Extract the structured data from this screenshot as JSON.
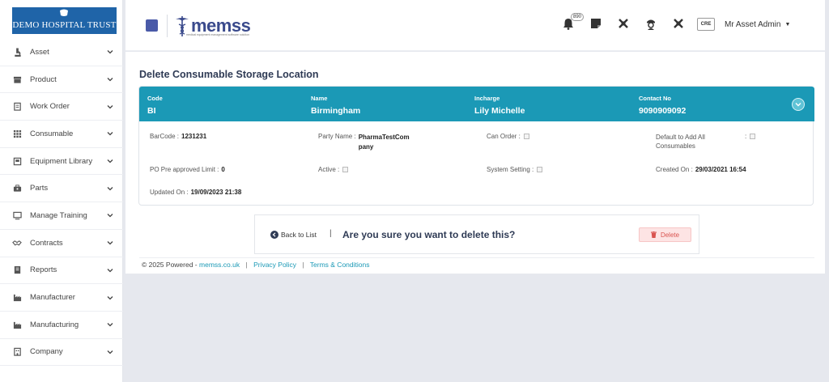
{
  "brand": {
    "name": "DEMO HOSPITAL TRUST",
    "bg": "#1f64a8"
  },
  "sidebar": {
    "items": [
      {
        "label": "Asset",
        "icon": "microscope-icon"
      },
      {
        "label": "Product",
        "icon": "box-icon"
      },
      {
        "label": "Work Order",
        "icon": "clipboard-icon"
      },
      {
        "label": "Consumable",
        "icon": "grid-icon"
      },
      {
        "label": "Equipment Library",
        "icon": "book-icon"
      },
      {
        "label": "Parts",
        "icon": "toolbox-icon"
      },
      {
        "label": "Manage Training",
        "icon": "monitor-icon"
      },
      {
        "label": "Contracts",
        "icon": "handshake-icon"
      },
      {
        "label": "Reports",
        "icon": "report-icon"
      },
      {
        "label": "Manufacturer",
        "icon": "factory-icon"
      },
      {
        "label": "Manufacturing",
        "icon": "factory-icon"
      },
      {
        "label": "Company",
        "icon": "building-icon"
      }
    ]
  },
  "topbar": {
    "logo_word": "memss",
    "logo_tagline": "medical equipment management software solution",
    "notification_count": "890",
    "user_name": "Mr Asset Admin",
    "avatar_text": "CRE"
  },
  "page": {
    "title": "Delete Consumable Storage Location"
  },
  "record": {
    "header": [
      {
        "label": "Code",
        "value": "BI"
      },
      {
        "label": "Name",
        "value": "Birmingham"
      },
      {
        "label": "Incharge",
        "value": "Lily Michelle"
      },
      {
        "label": "Contact No",
        "value": "9090909092"
      }
    ],
    "barcode_label": "BarCode :",
    "barcode_value": "1231231",
    "party_label": "Party Name :",
    "party_value_1": "PharmaTestCom",
    "party_value_2": "pany",
    "can_order_label": "Can Order :",
    "default_label_1": "Default to Add All",
    "default_label_2": "Consumables",
    "default_colon": ":",
    "po_label": "PO Pre approved Limit :",
    "po_value": "0",
    "active_label": "Active :",
    "system_label": "System Setting :",
    "created_label": "Created On :",
    "created_value": "29/03/2021 16:54",
    "updated_label": "Updated On :",
    "updated_value": "19/09/2023 21:38"
  },
  "confirm": {
    "back_label": "Back to List",
    "separator": "|",
    "question": "Are you sure you want to delete this?",
    "delete_label": "Delete"
  },
  "footer": {
    "powered": "© 2025 Powered -",
    "site": "memss.co.uk",
    "privacy": "Privacy Policy",
    "terms": "Terms & Conditions",
    "pipe": "|"
  },
  "colors": {
    "accent": "#1b99b6",
    "title": "#2f3b55",
    "danger": "#d9534f"
  }
}
